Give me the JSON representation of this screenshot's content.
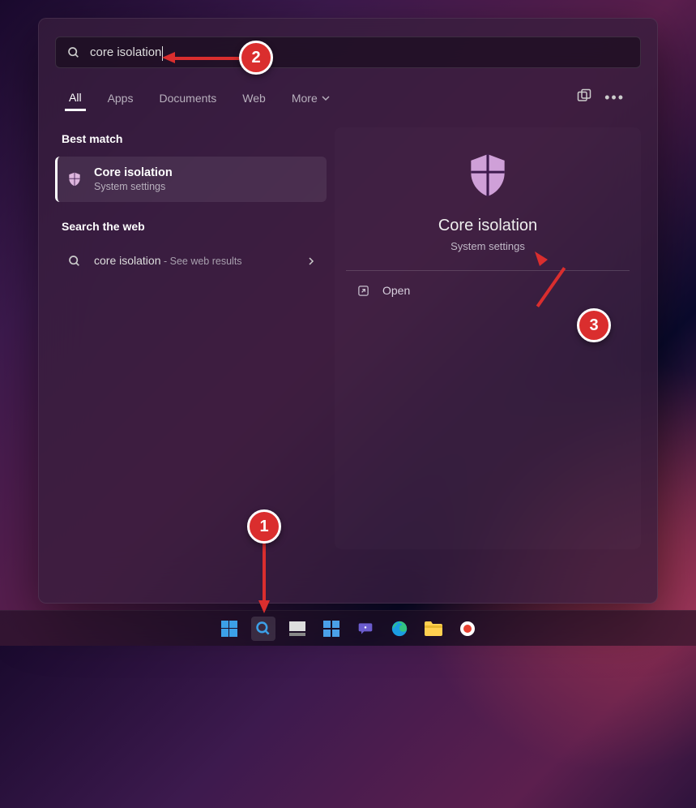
{
  "search": {
    "value": "core isolation"
  },
  "tabs": {
    "all": "All",
    "apps": "Apps",
    "documents": "Documents",
    "web": "Web",
    "more": "More"
  },
  "sections": {
    "best_match": "Best match",
    "search_web": "Search the web"
  },
  "best_result": {
    "title": "Core isolation",
    "subtitle": "System settings"
  },
  "web_result": {
    "title": "core isolation",
    "suffix": " - See web results"
  },
  "preview": {
    "title": "Core isolation",
    "subtitle": "System settings",
    "open": "Open"
  },
  "markers": {
    "m1": "1",
    "m2": "2",
    "m3": "3"
  }
}
